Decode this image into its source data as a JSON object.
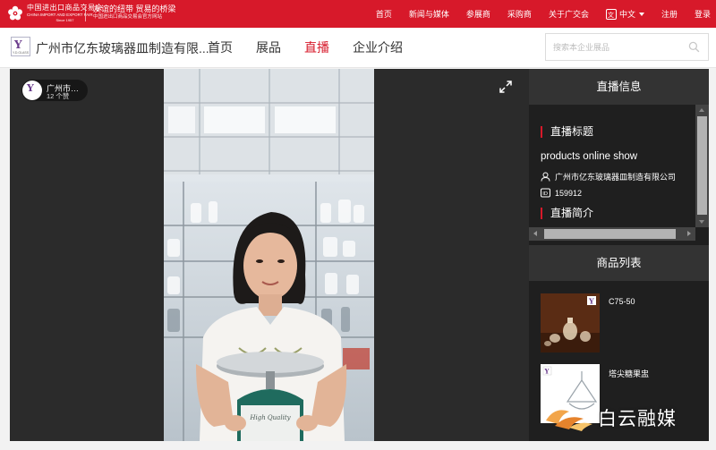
{
  "topbar": {
    "logo": {
      "name_cn": "中国进出口商品交易会",
      "name_en": "CHINA IMPORT AND EXPORT FAIR",
      "since": "Since 1957"
    },
    "slogan": {
      "line1": "友谊的纽带 贸易的桥梁",
      "line2": "中国进出口商品交易会官方网站"
    },
    "nav": [
      "首页",
      "新闻与媒体",
      "参展商",
      "采购商",
      "关于广交会"
    ],
    "language": "中文",
    "register": "注册",
    "login": "登录"
  },
  "header": {
    "company_name": "广州市亿东玻璃器皿制造有限...",
    "nav": [
      {
        "label": "首页",
        "active": false
      },
      {
        "label": "展品",
        "active": false
      },
      {
        "label": "直播",
        "active": true
      },
      {
        "label": "企业介绍",
        "active": false
      }
    ],
    "search_placeholder": "搜索本企业展品"
  },
  "player": {
    "author_name": "广州市…",
    "author_fans": "12 个赞"
  },
  "live_info": {
    "panel_title": "直播信息",
    "title_heading": "直播标题",
    "live_title": "products online show",
    "company": "广州市亿东玻璃器皿制造有限公司",
    "live_id": "159912",
    "intro_heading": "直播简介"
  },
  "product_list": {
    "panel_title": "商品列表",
    "items": [
      {
        "name": "C75-50"
      },
      {
        "name": "塔尖糖果盅"
      }
    ]
  },
  "watermark": "白云融媒",
  "colors": {
    "accent_red": "#d7192a",
    "panel_dark": "#1f1f1f",
    "panel_head": "#333333"
  }
}
